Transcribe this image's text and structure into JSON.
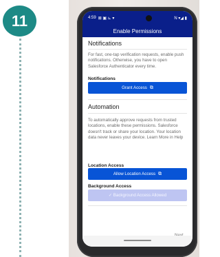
{
  "step": {
    "number": "11"
  },
  "status_bar": {
    "time": "4:59",
    "left_icons": "⊠ ▣ ⊾ ▾",
    "right_icons": "N ▾◢ ▮"
  },
  "app": {
    "title": "Enable Permissions"
  },
  "notifications": {
    "heading": "Notifications",
    "description": "For fast, one-tap verification requests, enable push notifications. Otherwise, you have to open Salesforce Authenticator every time.",
    "label": "Notifications",
    "button_label": "Grant Access"
  },
  "automation": {
    "heading": "Automation",
    "description": "To automatically approve requests from trusted locations, enable these permissions. Salesforce doesn't track or share your location. Your location data never leaves your device. Learn More in Help",
    "location_label": "Location Access",
    "location_button_label": "Allow Location Access",
    "background_label": "Background Access",
    "background_button_label": "✓ Background Access Allowed"
  },
  "footer": {
    "next_label": "Next"
  },
  "colors": {
    "badge": "#1d8a86",
    "header": "#0a1f8a",
    "button": "#0854d6",
    "button_disabled": "#bec5f2"
  }
}
